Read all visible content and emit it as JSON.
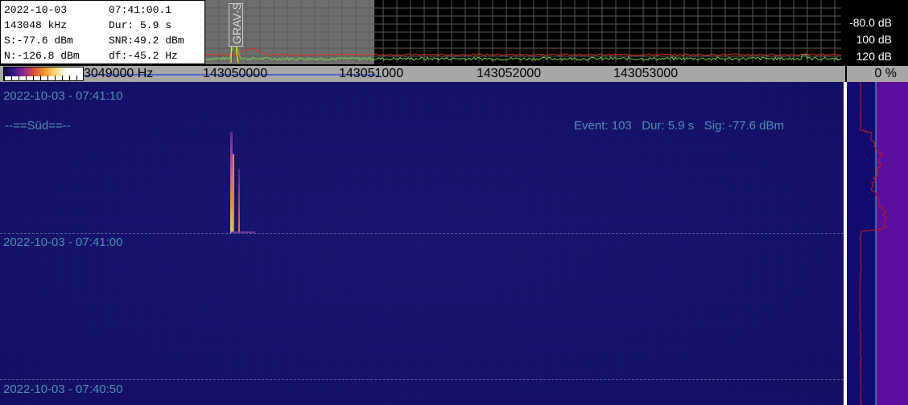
{
  "info_box": {
    "date": "2022-10-03",
    "time": "07:41:00.1",
    "frequency": "143048 kHz",
    "duration": "Dur: 5.9 s",
    "signal": "S:-77.6 dBm",
    "snr": "SNR:49.2 dBm",
    "noise": "N:-126.8 dBm",
    "df": "df:-45.2 Hz"
  },
  "spectrum": {
    "db_labels": [
      "-80.0 dB",
      "100 dB",
      "120 dB"
    ],
    "event_tag": "GRAV-S"
  },
  "freq_axis": {
    "labels": [
      "3049000 Hz",
      "143050000",
      "143051000",
      "143052000",
      "143053000"
    ]
  },
  "percent_label": "0 %",
  "waterfall": {
    "time_labels": [
      "2022-10-03 - 07:41:10",
      "2022-10-03 - 07:41:00",
      "2022-10-03 - 07:40:50"
    ],
    "site_label": "--==Süd==--",
    "event_info": "Event: 103   Dur: 5.9 s   Sig: -77.6 dBm"
  },
  "colors": {
    "waterfall_bg": "#15126a",
    "label_text": "#4f8fb2",
    "spectrum_green": "#7bd34a",
    "spectrum_red": "#e0302a",
    "right_panel": "#5a0e9e"
  }
}
